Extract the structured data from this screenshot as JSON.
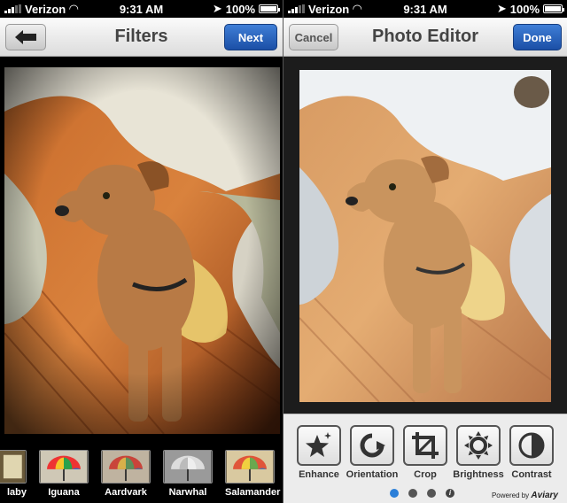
{
  "status": {
    "carrier": "Verizon",
    "time": "9:31 AM",
    "battery": "100%"
  },
  "left": {
    "title": "Filters",
    "next_label": "Next",
    "filters": [
      {
        "label": "laby"
      },
      {
        "label": "Iguana"
      },
      {
        "label": "Aardvark"
      },
      {
        "label": "Narwhal"
      },
      {
        "label": "Salamander"
      }
    ]
  },
  "right": {
    "title": "Photo Editor",
    "cancel_label": "Cancel",
    "done_label": "Done",
    "tools": [
      {
        "label": "Enhance",
        "icon": "sparkle-star-icon"
      },
      {
        "label": "Orientation",
        "icon": "rotate-icon"
      },
      {
        "label": "Crop",
        "icon": "crop-icon"
      },
      {
        "label": "Brightness",
        "icon": "sun-icon"
      },
      {
        "label": "Contrast",
        "icon": "contrast-icon"
      }
    ],
    "page_dots": {
      "count": 4,
      "active": 0
    },
    "powered_by": "Powered by",
    "powered_brand": "Aviary"
  },
  "colors": {
    "accent_blue": "#2b7fd8",
    "nav_bg": "#e8e8e8"
  }
}
